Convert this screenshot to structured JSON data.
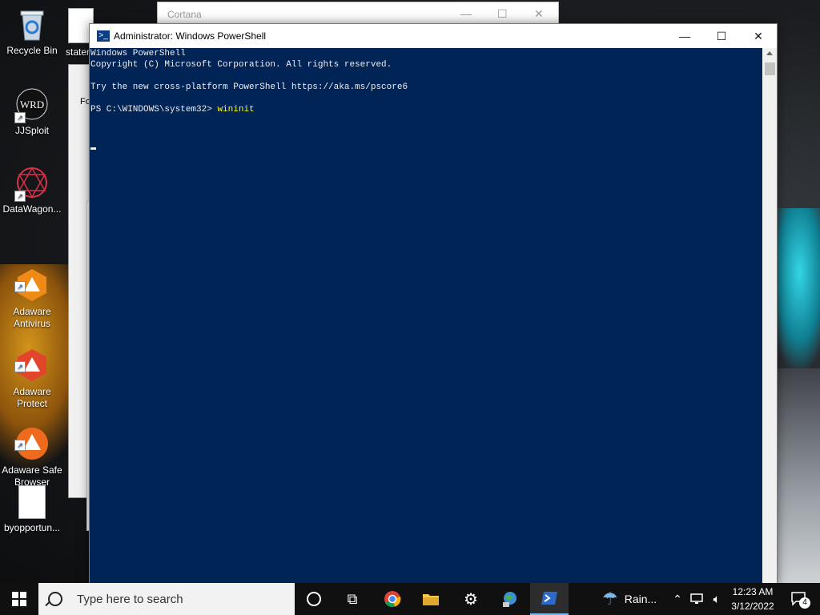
{
  "desktop": {
    "icons": [
      {
        "label": "Recycle Bin",
        "icon": "recycle-bin-icon"
      },
      {
        "label": "JJSploit",
        "icon": "jjsploit-icon"
      },
      {
        "label": "DataWagon...",
        "icon": "datawagon-icon"
      },
      {
        "label": "Adaware\nAntivirus",
        "icon": "adaware-antivirus-icon"
      },
      {
        "label": "Adaware\nProtect",
        "icon": "adaware-protect-icon"
      },
      {
        "label": "Adaware Safe\nBrowser",
        "icon": "adaware-safe-browser-icon"
      },
      {
        "label": "byopportun...",
        "icon": "document-icon"
      },
      {
        "label": "stater",
        "icon": "document-icon"
      }
    ]
  },
  "background_windows": {
    "cortana_title": "Cortana",
    "partial_window_text": "Fo"
  },
  "powershell": {
    "title": "Administrator: Windows PowerShell",
    "lines": [
      "Windows PowerShell",
      "Copyright (C) Microsoft Corporation. All rights reserved.",
      "",
      "Try the new cross-platform PowerShell https://aka.ms/pscore6",
      ""
    ],
    "prompt": "PS C:\\WINDOWS\\system32> ",
    "command": "wininit"
  },
  "taskbar": {
    "search_placeholder": "Type here to search",
    "weather": "Rain...",
    "time": "12:23 AM",
    "date": "3/12/2022",
    "notification_count": "4",
    "accent": "#76b9ed"
  }
}
